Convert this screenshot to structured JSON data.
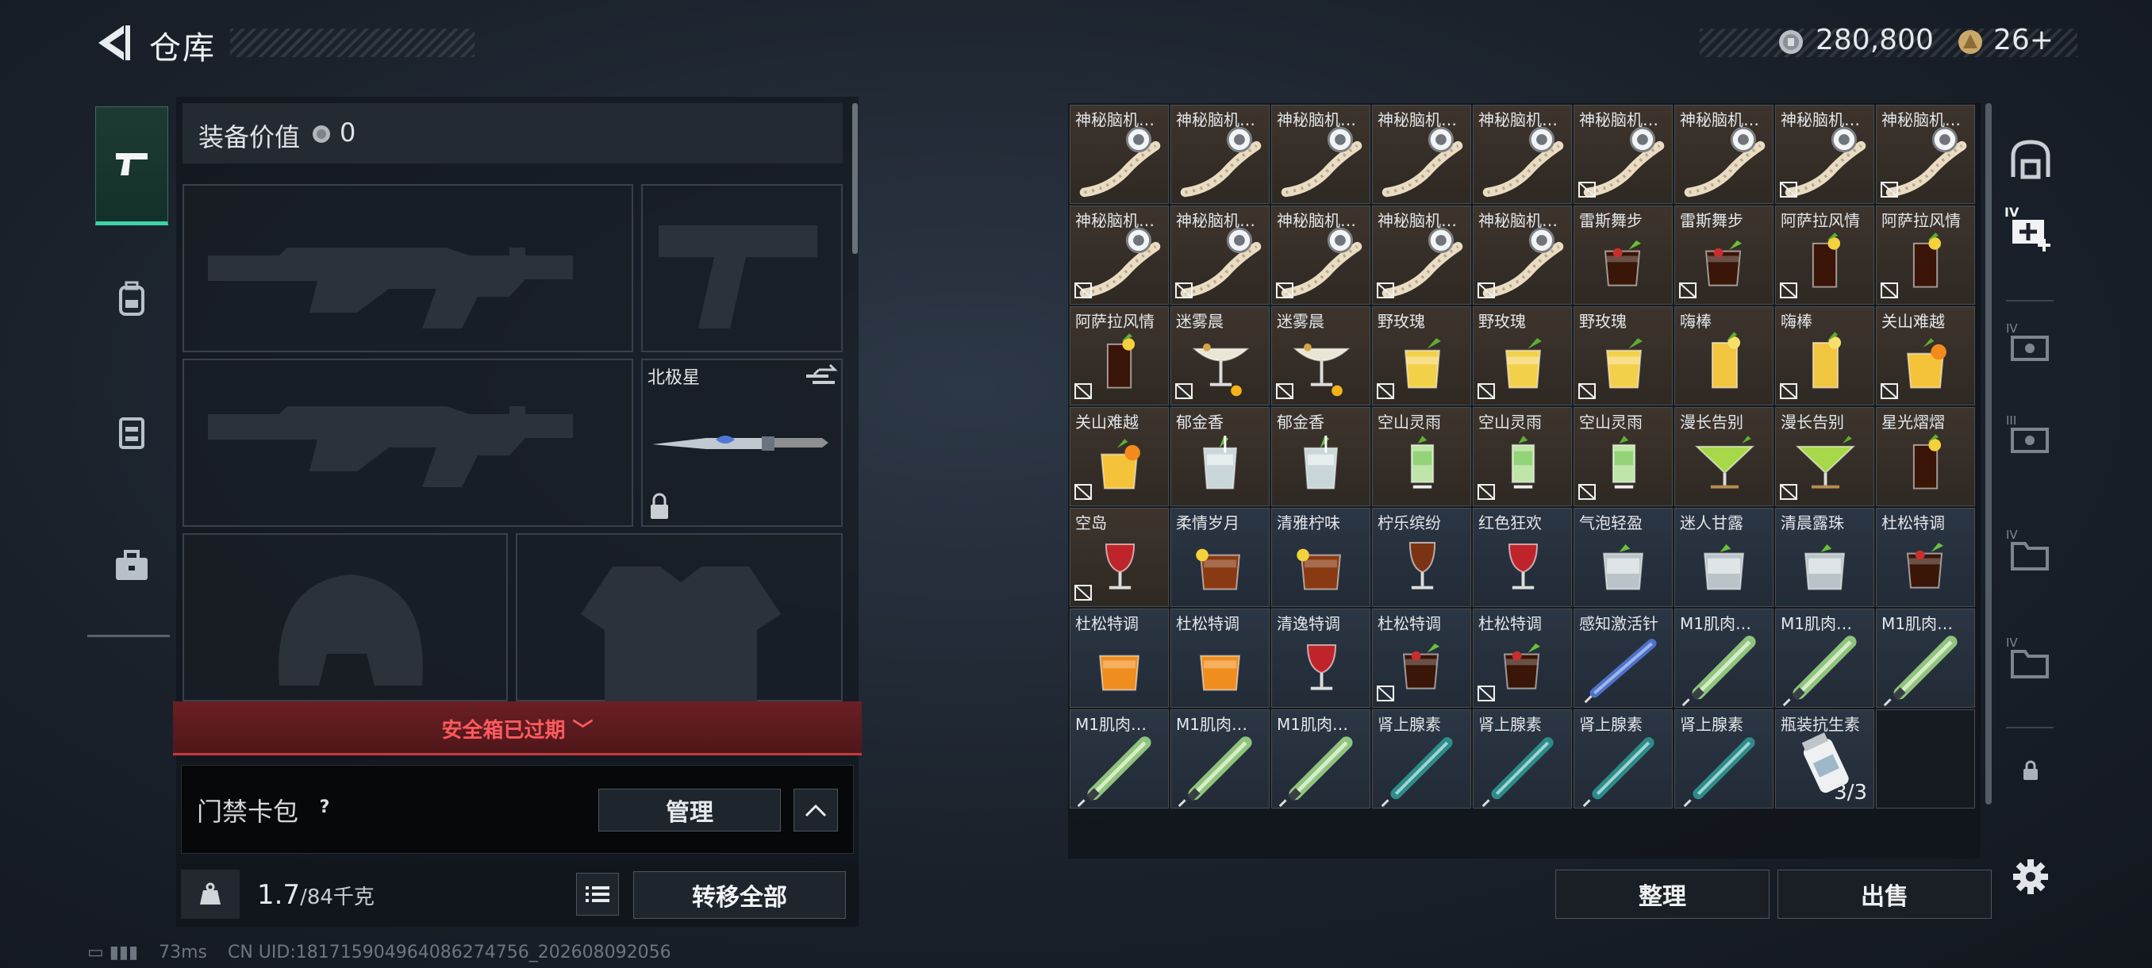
{
  "header": {
    "title": "仓库",
    "money": "280,800",
    "tickets": "26+"
  },
  "loadout": {
    "equip_value_label": "装备价值",
    "equip_value": "0",
    "slot_knife_name": "北极星",
    "safe_box": "安全箱已过期",
    "card_pack_label": "门禁卡包",
    "card_pack_help": "?",
    "manage_label": "管理",
    "weight_value": "1.7",
    "weight_max": "/84千克",
    "transfer_label": "转移全部"
  },
  "status": {
    "ping": "73ms",
    "uid": "CN UID:1817159049640862747​56_202608092056"
  },
  "inventory": {
    "sort_label": "整理",
    "sell_label": "出售",
    "items": [
      {
        "name": "神秘脑机…",
        "type": "brain",
        "lock": false,
        "bg": "b"
      },
      {
        "name": "神秘脑机…",
        "type": "brain",
        "lock": false,
        "bg": "b"
      },
      {
        "name": "神秘脑机…",
        "type": "brain",
        "lock": false,
        "bg": "b"
      },
      {
        "name": "神秘脑机…",
        "type": "brain",
        "lock": false,
        "bg": "b"
      },
      {
        "name": "神秘脑机…",
        "type": "brain",
        "lock": false,
        "bg": "b"
      },
      {
        "name": "神秘脑机…",
        "type": "brain",
        "lock": true,
        "bg": "b"
      },
      {
        "name": "神秘脑机…",
        "type": "brain",
        "lock": false,
        "bg": "b"
      },
      {
        "name": "神秘脑机…",
        "type": "brain",
        "lock": true,
        "bg": "b"
      },
      {
        "name": "神秘脑机…",
        "type": "brain",
        "lock": true,
        "bg": "b"
      },
      {
        "name": "神秘脑机…",
        "type": "brain",
        "lock": true,
        "bg": "b"
      },
      {
        "name": "神秘脑机…",
        "type": "brain",
        "lock": true,
        "bg": "b"
      },
      {
        "name": "神秘脑机…",
        "type": "brain",
        "lock": true,
        "bg": "b"
      },
      {
        "name": "神秘脑机…",
        "type": "brain",
        "lock": true,
        "bg": "b"
      },
      {
        "name": "神秘脑机…",
        "type": "brain",
        "lock": true,
        "bg": "b"
      },
      {
        "name": "雷斯舞步",
        "type": "cola",
        "lock": false,
        "bg": "b"
      },
      {
        "name": "雷斯舞步",
        "type": "cola",
        "lock": true,
        "bg": "b"
      },
      {
        "name": "阿萨拉风情",
        "type": "tallcola",
        "lock": true,
        "bg": "b"
      },
      {
        "name": "阿萨拉风情",
        "type": "tallcola",
        "lock": true,
        "bg": "b"
      },
      {
        "name": "阿萨拉风情",
        "type": "tallcola",
        "lock": true,
        "bg": "b"
      },
      {
        "name": "迷雾晨",
        "type": "coupe",
        "lock": true,
        "bg": "b"
      },
      {
        "name": "迷雾晨",
        "type": "coupe",
        "lock": true,
        "bg": "b"
      },
      {
        "name": "野玫瑰",
        "type": "yellow",
        "lock": true,
        "bg": "b"
      },
      {
        "name": "野玫瑰",
        "type": "yellow",
        "lock": true,
        "bg": "b"
      },
      {
        "name": "野玫瑰",
        "type": "yellow",
        "lock": true,
        "bg": "b"
      },
      {
        "name": "嗨棒",
        "type": "yellowtall",
        "lock": false,
        "bg": "b"
      },
      {
        "name": "嗨棒",
        "type": "yellowtall",
        "lock": true,
        "bg": "b"
      },
      {
        "name": "关山难越",
        "type": "orange",
        "lock": true,
        "bg": "b"
      },
      {
        "name": "关山难越",
        "type": "orange",
        "lock": true,
        "bg": "b"
      },
      {
        "name": "郁金香",
        "type": "clear",
        "lock": false,
        "bg": "b"
      },
      {
        "name": "郁金香",
        "type": "clear",
        "lock": false,
        "bg": "b"
      },
      {
        "name": "空山灵雨",
        "type": "green",
        "lock": false,
        "bg": "b"
      },
      {
        "name": "空山灵雨",
        "type": "green",
        "lock": true,
        "bg": "b"
      },
      {
        "name": "空山灵雨",
        "type": "green",
        "lock": true,
        "bg": "b"
      },
      {
        "name": "漫长告别",
        "type": "martini",
        "lock": false,
        "bg": "b"
      },
      {
        "name": "漫长告别",
        "type": "martini",
        "lock": true,
        "bg": "b"
      },
      {
        "name": "星光熠熠",
        "type": "tallcola",
        "lock": false,
        "bg": "b"
      },
      {
        "name": "空岛",
        "type": "redwine",
        "lock": true,
        "bg": "b"
      },
      {
        "name": "柔情岁月",
        "type": "amberrocks",
        "lock": false,
        "bg": "n"
      },
      {
        "name": "清雅柠味",
        "type": "amberrocks",
        "lock": false,
        "bg": "n"
      },
      {
        "name": "柠乐缤纷",
        "type": "brownwine",
        "lock": false,
        "bg": "n"
      },
      {
        "name": "红色狂欢",
        "type": "redwine",
        "lock": false,
        "bg": "n"
      },
      {
        "name": "气泡轻盈",
        "type": "clearrocks",
        "lock": false,
        "bg": "n"
      },
      {
        "name": "迷人甘露",
        "type": "clearrocks",
        "lock": false,
        "bg": "n"
      },
      {
        "name": "清晨露珠",
        "type": "clearrocks",
        "lock": false,
        "bg": "n"
      },
      {
        "name": "杜松特调",
        "type": "cola",
        "lock": false,
        "bg": "n"
      },
      {
        "name": "杜松特调",
        "type": "orangerocks",
        "lock": false,
        "bg": "n"
      },
      {
        "name": "杜松特调",
        "type": "orangerocks",
        "lock": false,
        "bg": "n"
      },
      {
        "name": "清逸特调",
        "type": "redwine",
        "lock": false,
        "bg": "n"
      },
      {
        "name": "杜松特调",
        "type": "cola",
        "lock": true,
        "bg": "n"
      },
      {
        "name": "杜松特调",
        "type": "cola",
        "lock": true,
        "bg": "n"
      },
      {
        "name": "感知激活针",
        "type": "syringe_blue",
        "lock": false,
        "bg": "n"
      },
      {
        "name": "M1肌肉…",
        "type": "syringe_green",
        "lock": false,
        "bg": "n"
      },
      {
        "name": "M1肌肉…",
        "type": "syringe_green",
        "lock": false,
        "bg": "n"
      },
      {
        "name": "M1肌肉…",
        "type": "syringe_green",
        "lock": false,
        "bg": "n"
      },
      {
        "name": "M1肌肉…",
        "type": "syringe_green",
        "lock": false,
        "bg": "n"
      },
      {
        "name": "M1肌肉…",
        "type": "syringe_green",
        "lock": false,
        "bg": "n"
      },
      {
        "name": "M1肌肉…",
        "type": "syringe_green",
        "lock": false,
        "bg": "n"
      },
      {
        "name": "肾上腺素",
        "type": "syringe_teal",
        "lock": false,
        "bg": "n"
      },
      {
        "name": "肾上腺素",
        "type": "syringe_teal",
        "lock": false,
        "bg": "n"
      },
      {
        "name": "肾上腺素",
        "type": "syringe_teal",
        "lock": false,
        "bg": "n"
      },
      {
        "name": "肾上腺素",
        "type": "syringe_teal",
        "lock": false,
        "bg": "n"
      },
      {
        "name": "瓶装抗生素",
        "type": "bottle",
        "lock": false,
        "bg": "n",
        "count": "3/3"
      }
    ]
  },
  "icons": {
    "back": "chevron-left-icon",
    "coin": "coin-icon",
    "ticket": "ticket-icon",
    "nav": [
      "pistol-icon",
      "backpack-icon",
      "chest-rig-icon",
      "toolbox-icon"
    ],
    "right_nav": [
      "safe-box-icon",
      "add-slot-icon",
      "case-slot-icon",
      "case-slot-icon",
      "folder-slot-icon",
      "folder-slot-icon",
      "lock-icon",
      "gear-icon"
    ]
  }
}
